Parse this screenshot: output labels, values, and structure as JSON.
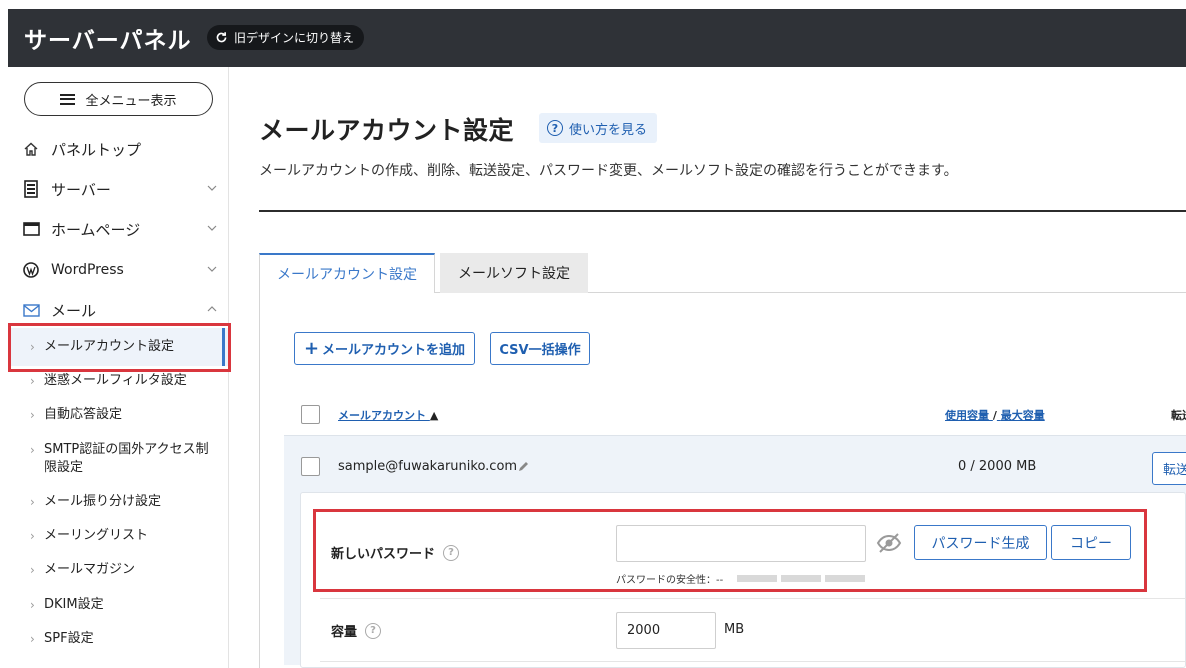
{
  "header": {
    "brand": "サーバーパネル",
    "switch_label": "旧デザインに切り替え"
  },
  "sidebar": {
    "menu_all": "全メニュー表示",
    "top_items": [
      {
        "label": "パネルトップ",
        "icon": "home-icon"
      },
      {
        "label": "サーバー",
        "icon": "server-icon"
      },
      {
        "label": "ホームページ",
        "icon": "browser-window-icon"
      },
      {
        "label": "WordPress",
        "icon": "wordpress-icon"
      },
      {
        "label": "メール",
        "icon": "mail-icon"
      }
    ],
    "mail_sub_items": [
      {
        "label": "メールアカウント設定"
      },
      {
        "label": "迷惑メールフィルタ設定"
      },
      {
        "label": "自動応答設定"
      },
      {
        "label": "SMTP認証の国外アクセス制限設定"
      },
      {
        "label": "メール振り分け設定"
      },
      {
        "label": "メーリングリスト"
      },
      {
        "label": "メールマガジン"
      },
      {
        "label": "DKIM設定"
      },
      {
        "label": "SPF設定"
      }
    ]
  },
  "main": {
    "title": "メールアカウント設定",
    "help_label": "使い方を見る",
    "description": "メールアカウントの作成、削除、転送設定、パスワード変更、メールソフト設定の確認を行うことができます。",
    "tabs": [
      {
        "label": "メールアカウント設定",
        "active": true
      },
      {
        "label": "メールソフト設定",
        "active": false
      }
    ],
    "add_button": "メールアカウントを追加",
    "csv_button": "CSV一括操作",
    "table": {
      "col_account": "メールアカウント",
      "sort_indicator": "▲",
      "col_usage": "使用容量",
      "col_usage_sep": "/",
      "col_capacity": "最大容量",
      "col_forward": "転送",
      "rows": [
        {
          "email": "sample@fuwakaruniko.com",
          "usage": "0 / 2000 MB",
          "forward_button": "転送"
        }
      ]
    },
    "detail": {
      "new_password_label": "新しいパスワード",
      "new_password_value": "",
      "generate_button": "パスワード生成",
      "copy_button": "コピー",
      "strength_label": "パスワードの安全性：--",
      "capacity_label": "容量",
      "capacity_value": "2000",
      "capacity_unit": "MB"
    }
  },
  "colors": {
    "header_bg": "#2f3237",
    "accent": "#3a78c9",
    "highlight_border": "#d9363e"
  }
}
